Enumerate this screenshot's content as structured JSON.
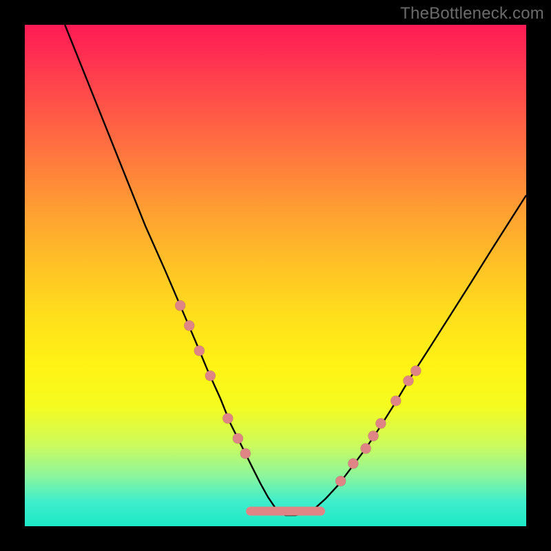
{
  "watermark": "TheBottleneck.com",
  "colors": {
    "frame": "#000000",
    "curve": "#000000",
    "dots": "#e08585",
    "gradient_top": "#ff1a55",
    "gradient_bottom": "#1de9c7"
  },
  "chart_data": {
    "type": "line",
    "title": "",
    "xlabel": "",
    "ylabel": "",
    "xlim": [
      0,
      100
    ],
    "ylim": [
      0,
      100
    ],
    "series": [
      {
        "name": "bottleneck-curve",
        "x": [
          8,
          12,
          16,
          20,
          24,
          28,
          31,
          34,
          36.5,
          39,
          41,
          43.5,
          45.5,
          47,
          48.5,
          50,
          51,
          52,
          54,
          56,
          58,
          60,
          62.5,
          65,
          68,
          71,
          74,
          77,
          81,
          85,
          89,
          93,
          97,
          100
        ],
        "y": [
          100,
          90,
          80,
          70,
          60,
          51,
          44,
          37,
          31,
          25.5,
          20.5,
          15.5,
          11.5,
          8.5,
          5.8,
          3.6,
          2.5,
          2.2,
          2.2,
          2.6,
          3.7,
          5.5,
          8.2,
          11.5,
          15.5,
          20,
          24.8,
          29.8,
          36,
          42.3,
          48.6,
          55,
          61.3,
          66
        ]
      }
    ],
    "markers": {
      "name": "highlight-dots",
      "points": [
        {
          "x": 31.0,
          "y": 44.0
        },
        {
          "x": 32.8,
          "y": 40.0
        },
        {
          "x": 34.8,
          "y": 35.0
        },
        {
          "x": 37.0,
          "y": 30.0
        },
        {
          "x": 40.5,
          "y": 21.5
        },
        {
          "x": 42.5,
          "y": 17.5
        },
        {
          "x": 44.0,
          "y": 14.5
        },
        {
          "x": 63.0,
          "y": 9.0
        },
        {
          "x": 65.5,
          "y": 12.5
        },
        {
          "x": 68.0,
          "y": 15.5
        },
        {
          "x": 69.5,
          "y": 18.0
        },
        {
          "x": 71.0,
          "y": 20.5
        },
        {
          "x": 74.0,
          "y": 25.0
        },
        {
          "x": 76.5,
          "y": 29.0
        },
        {
          "x": 78.0,
          "y": 31.0
        }
      ],
      "plateau": {
        "x0": 45.0,
        "x1": 59.0,
        "y": 3.0
      }
    }
  }
}
